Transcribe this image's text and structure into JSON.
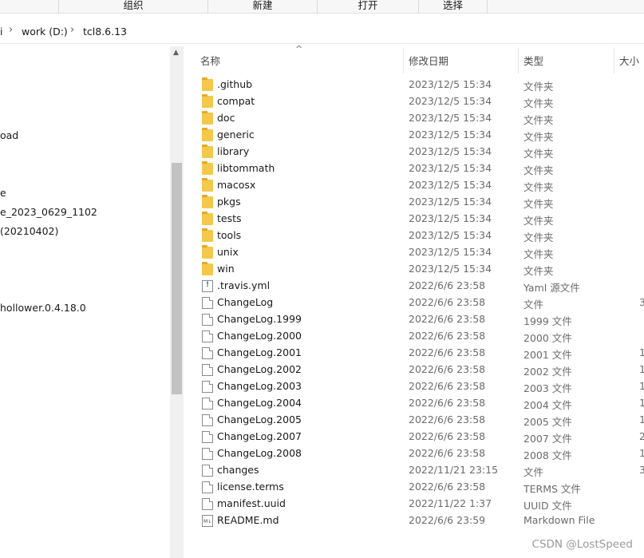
{
  "ribbon": {
    "sections": [
      "组织",
      "新建",
      "打开",
      "选择"
    ]
  },
  "address": {
    "prefix": "i",
    "drive": "work (D:)",
    "folder": "tcl8.6.13"
  },
  "nav": {
    "items": [
      "oad",
      "e",
      "e_2023_0629_1102",
      "(20210402)",
      "hollower.0.4.18.0"
    ]
  },
  "columns": {
    "name": "名称",
    "modified": "修改日期",
    "type": "类型",
    "size": "大小"
  },
  "files": [
    {
      "name": ".github",
      "date": "2023/12/5 15:34",
      "type": "文件夹",
      "size": "",
      "icon": "folder-icon"
    },
    {
      "name": "compat",
      "date": "2023/12/5 15:34",
      "type": "文件夹",
      "size": "",
      "icon": "folder-icon"
    },
    {
      "name": "doc",
      "date": "2023/12/5 15:34",
      "type": "文件夹",
      "size": "",
      "icon": "folder-icon"
    },
    {
      "name": "generic",
      "date": "2023/12/5 15:34",
      "type": "文件夹",
      "size": "",
      "icon": "folder-icon"
    },
    {
      "name": "library",
      "date": "2023/12/5 15:34",
      "type": "文件夹",
      "size": "",
      "icon": "folder-icon"
    },
    {
      "name": "libtommath",
      "date": "2023/12/5 15:34",
      "type": "文件夹",
      "size": "",
      "icon": "folder-icon"
    },
    {
      "name": "macosx",
      "date": "2023/12/5 15:34",
      "type": "文件夹",
      "size": "",
      "icon": "folder-icon"
    },
    {
      "name": "pkgs",
      "date": "2023/12/5 15:34",
      "type": "文件夹",
      "size": "",
      "icon": "folder-icon"
    },
    {
      "name": "tests",
      "date": "2023/12/5 15:34",
      "type": "文件夹",
      "size": "",
      "icon": "folder-icon"
    },
    {
      "name": "tools",
      "date": "2023/12/5 15:34",
      "type": "文件夹",
      "size": "",
      "icon": "folder-icon"
    },
    {
      "name": "unix",
      "date": "2023/12/5 15:34",
      "type": "文件夹",
      "size": "",
      "icon": "folder-icon"
    },
    {
      "name": "win",
      "date": "2023/12/5 15:34",
      "type": "文件夹",
      "size": "",
      "icon": "folder-icon"
    },
    {
      "name": ".travis.yml",
      "date": "2022/6/6 23:58",
      "type": "Yaml 源文件",
      "size": "",
      "icon": "yaml-file-icon"
    },
    {
      "name": "ChangeLog",
      "date": "2022/6/6 23:58",
      "type": "文件",
      "size": "3",
      "icon": "file-icon"
    },
    {
      "name": "ChangeLog.1999",
      "date": "2022/6/6 23:58",
      "type": "1999 文件",
      "size": "",
      "icon": "file-icon"
    },
    {
      "name": "ChangeLog.2000",
      "date": "2022/6/6 23:58",
      "type": "2000 文件",
      "size": "",
      "icon": "file-icon"
    },
    {
      "name": "ChangeLog.2001",
      "date": "2022/6/6 23:58",
      "type": "2001 文件",
      "size": "1",
      "icon": "file-icon"
    },
    {
      "name": "ChangeLog.2002",
      "date": "2022/6/6 23:58",
      "type": "2002 文件",
      "size": "1",
      "icon": "file-icon"
    },
    {
      "name": "ChangeLog.2003",
      "date": "2022/6/6 23:58",
      "type": "2003 文件",
      "size": "1",
      "icon": "file-icon"
    },
    {
      "name": "ChangeLog.2004",
      "date": "2022/6/6 23:58",
      "type": "2004 文件",
      "size": "1",
      "icon": "file-icon"
    },
    {
      "name": "ChangeLog.2005",
      "date": "2022/6/6 23:58",
      "type": "2005 文件",
      "size": "1",
      "icon": "file-icon"
    },
    {
      "name": "ChangeLog.2007",
      "date": "2022/6/6 23:58",
      "type": "2007 文件",
      "size": "2",
      "icon": "file-icon"
    },
    {
      "name": "ChangeLog.2008",
      "date": "2022/6/6 23:58",
      "type": "2008 文件",
      "size": "1",
      "icon": "file-icon"
    },
    {
      "name": "changes",
      "date": "2022/11/21 23:15",
      "type": "文件",
      "size": "3",
      "icon": "file-icon"
    },
    {
      "name": "license.terms",
      "date": "2022/6/6 23:58",
      "type": "TERMS 文件",
      "size": "",
      "icon": "file-icon"
    },
    {
      "name": "manifest.uuid",
      "date": "2022/11/22 1:37",
      "type": "UUID 文件",
      "size": "",
      "icon": "file-icon"
    },
    {
      "name": "README.md",
      "date": "2022/6/6 23:59",
      "type": "Markdown File",
      "size": "",
      "icon": "markdown-file-icon"
    }
  ],
  "watermark": "CSDN @LostSpeed"
}
